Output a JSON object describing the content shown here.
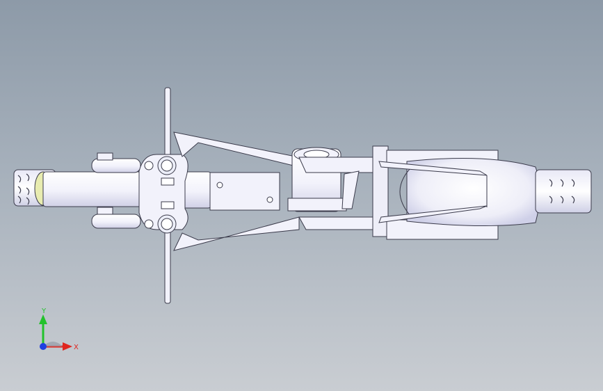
{
  "viewport": {
    "background": "gradient-gray-blue"
  },
  "model": {
    "part_fill": "#f2f2fb",
    "part_shade": "#d8d8ee",
    "edge_color": "#3a3a4a",
    "highlight_color": "#b8bde8",
    "lens_color": "#e8ecb0"
  },
  "triad": {
    "y_label": "Y",
    "x_label": "X",
    "y_color": "#22c22b",
    "x_color": "#e0261f",
    "z_color": "#1f3fe0"
  }
}
